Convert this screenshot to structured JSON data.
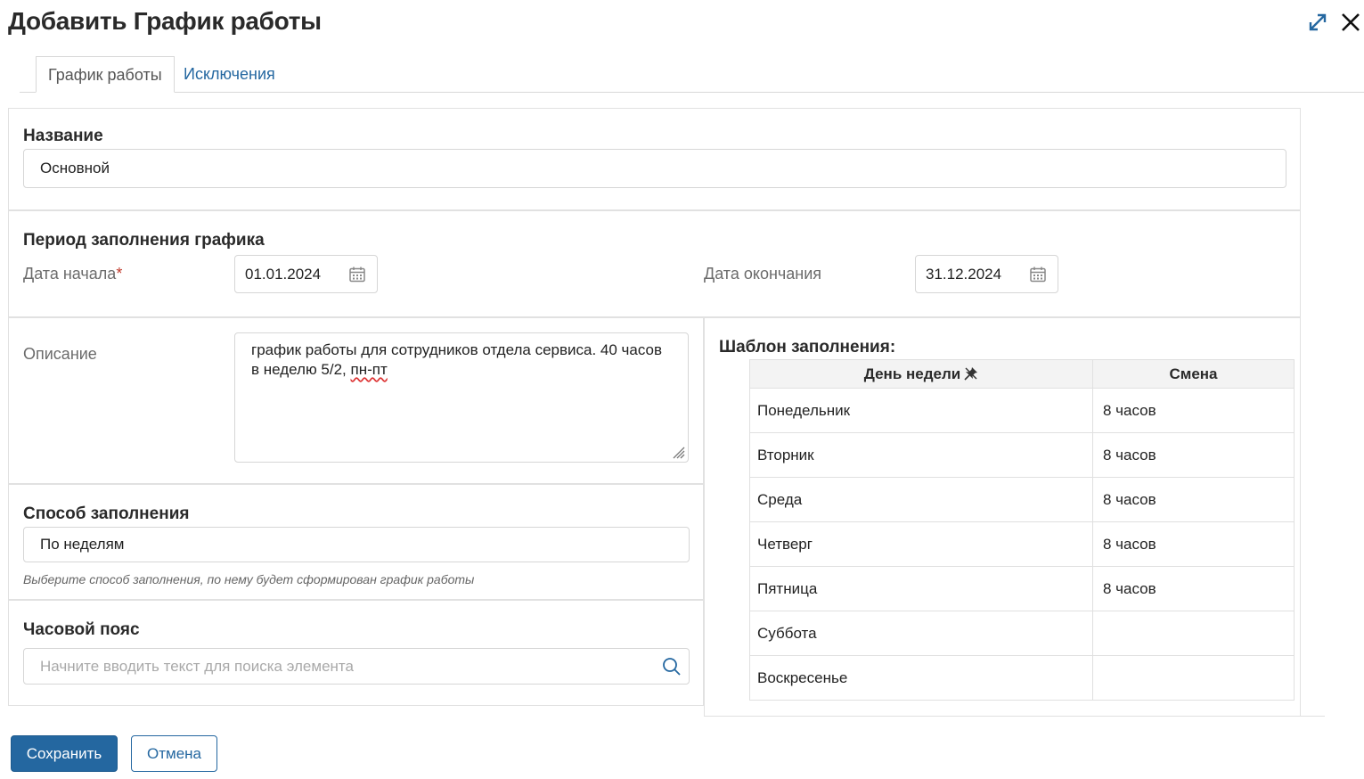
{
  "dialog": {
    "title": "Добавить График работы"
  },
  "tabs": [
    {
      "label": "График работы"
    },
    {
      "label": "Исключения"
    }
  ],
  "name_section": {
    "label": "Название",
    "value": "Основной"
  },
  "period_section": {
    "label": "Период заполнения графика",
    "start_label": "Дата начала",
    "required_mark": "*",
    "start_value": "01.01.2024",
    "end_label": "Дата окончания",
    "end_value": "31.12.2024"
  },
  "description_section": {
    "label": "Описание",
    "value_part1": "график работы для сотрудников отдела сервиса. 40 часов в неделю 5/2, ",
    "value_misspelled": "пн-пт"
  },
  "fill_method_section": {
    "label": "Способ заполнения",
    "value": "По неделям",
    "hint": "Выберите способ заполнения, по нему будет сформирован график работы"
  },
  "timezone_section": {
    "label": "Часовой пояс",
    "placeholder": "Начните вводить текст для поиска элемента"
  },
  "template_section": {
    "label": "Шаблон заполнения:",
    "columns": [
      "День недели",
      "Смена"
    ],
    "rows": [
      {
        "day": "Понедельник",
        "shift": "8 часов"
      },
      {
        "day": "Вторник",
        "shift": "8 часов"
      },
      {
        "day": "Среда",
        "shift": "8 часов"
      },
      {
        "day": "Четверг",
        "shift": "8 часов"
      },
      {
        "day": "Пятница",
        "shift": "8 часов"
      },
      {
        "day": "Суббота",
        "shift": ""
      },
      {
        "day": "Воскресенье",
        "shift": ""
      }
    ]
  },
  "footer": {
    "save_label": "Сохранить",
    "cancel_label": "Отмена"
  },
  "colors": {
    "accent": "#2467a0",
    "required": "#c0392b"
  }
}
